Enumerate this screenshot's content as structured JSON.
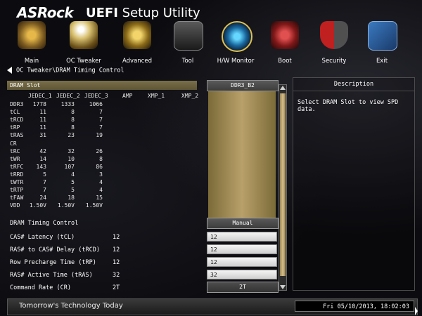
{
  "brand": {
    "logo": "ASRock",
    "title_bold": "UEFI",
    "title_light": "Setup Utility"
  },
  "nav": [
    {
      "label": "Main",
      "icon": "main-icon"
    },
    {
      "label": "OC Tweaker",
      "icon": "rocket-icon"
    },
    {
      "label": "Advanced",
      "icon": "star-icon"
    },
    {
      "label": "Tool",
      "icon": "toolbox-icon"
    },
    {
      "label": "H/W Monitor",
      "icon": "radar-icon"
    },
    {
      "label": "Boot",
      "icon": "boot-icon"
    },
    {
      "label": "Security",
      "icon": "shield-icon"
    },
    {
      "label": "Exit",
      "icon": "exit-icon"
    }
  ],
  "breadcrumb": "OC Tweaker\\DRAM Timing Control",
  "spd": {
    "header": "DRAM Slot",
    "columns": [
      "JEDEC_1",
      "JEDEC_2",
      "JEDEC_3",
      "AMP",
      "XMP_1",
      "XMP_2"
    ],
    "rows": [
      {
        "label": "DDR3",
        "values": [
          "1778",
          "1333",
          "1066"
        ]
      },
      {
        "label": "tCL",
        "values": [
          "11",
          "8",
          "7"
        ]
      },
      {
        "label": "tRCD",
        "values": [
          "11",
          "8",
          "7"
        ]
      },
      {
        "label": "tRP",
        "values": [
          "11",
          "8",
          "7"
        ]
      },
      {
        "label": "tRAS",
        "values": [
          "31",
          "23",
          "19"
        ]
      },
      {
        "label": "CR",
        "values": [
          "",
          "",
          ""
        ]
      },
      {
        "label": "tRC",
        "values": [
          "42",
          "32",
          "26"
        ]
      },
      {
        "label": "tWR",
        "values": [
          "14",
          "10",
          "8"
        ]
      },
      {
        "label": "tRFC",
        "values": [
          "143",
          "107",
          "86"
        ]
      },
      {
        "label": "tRRD",
        "values": [
          "5",
          "4",
          "3"
        ]
      },
      {
        "label": "tWTR",
        "values": [
          "7",
          "5",
          "4"
        ]
      },
      {
        "label": "tRTP",
        "values": [
          "7",
          "5",
          "4"
        ]
      },
      {
        "label": "tFAW",
        "values": [
          "24",
          "18",
          "15"
        ]
      },
      {
        "label": "VDD",
        "values": [
          "1.50V",
          "1.50V",
          "1.50V"
        ]
      }
    ]
  },
  "slot_button": "DDR3_B2",
  "timing": {
    "title": "DRAM Timing Control",
    "mode": "Manual",
    "items": [
      {
        "label": "CAS# Latency (tCL)",
        "value": "12",
        "field": "12"
      },
      {
        "label": "RAS# to CAS# Delay (tRCD)",
        "value": "12",
        "field": "12"
      },
      {
        "label": "Row Precharge Time (tRP)",
        "value": "12",
        "field": "12"
      },
      {
        "label": "RAS# Active Time (tRAS)",
        "value": "32",
        "field": "32"
      },
      {
        "label": "Command Rate (CR)",
        "value": "2T",
        "field": "2T"
      }
    ]
  },
  "description": {
    "title": "Description",
    "text": "Select DRAM Slot to view SPD data."
  },
  "footer": {
    "slogan": "Tomorrow's Technology Today",
    "datetime": "Fri 05/10/2013, 18:02:03"
  }
}
